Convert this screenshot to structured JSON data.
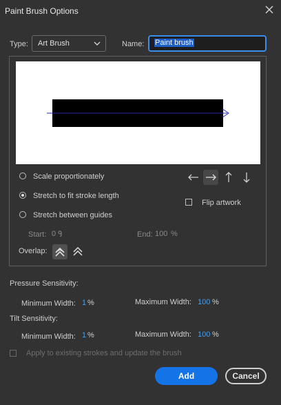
{
  "window": {
    "title": "Paint Brush Options"
  },
  "type_field": {
    "label": "Type:",
    "value": "Art Brush"
  },
  "name_field": {
    "label": "Name:",
    "value": "Paint brush"
  },
  "scaling": {
    "options": [
      {
        "label": "Scale proportionately",
        "selected": false
      },
      {
        "label": "Stretch to fit stroke length",
        "selected": true
      },
      {
        "label": "Stretch between guides",
        "selected": false
      }
    ],
    "start_label": "Start:",
    "start_value": "0",
    "end_label": "End:",
    "end_value": "100",
    "end_unit": "%"
  },
  "direction": {
    "buttons": [
      "arrow-left-icon",
      "arrow-right-icon",
      "arrow-up-icon",
      "arrow-down-icon"
    ],
    "active": "arrow-right-icon"
  },
  "flip": {
    "label": "Flip artwork",
    "checked": false
  },
  "overlap": {
    "label": "Overlap:"
  },
  "pressure": {
    "heading": "Pressure Sensitivity:",
    "min_label": "Minimum Width:",
    "min_value": "1",
    "min_unit": "%",
    "max_label": "Maximum Width:",
    "max_value": "100",
    "max_unit": "%"
  },
  "tilt": {
    "heading": "Tilt Sensitivity:",
    "min_label": "Minimum Width:",
    "min_value": "1",
    "min_unit": "%",
    "max_label": "Maximum Width:",
    "max_value": "100",
    "max_unit": "%"
  },
  "apply_existing": {
    "label": "Apply to existing strokes and update the brush",
    "checked": false
  },
  "buttons": {
    "add": "Add",
    "cancel": "Cancel"
  },
  "colors": {
    "accent": "#1473e6",
    "value_blue": "#4a9ee6",
    "preview_arrow": "#2a2aa8"
  }
}
